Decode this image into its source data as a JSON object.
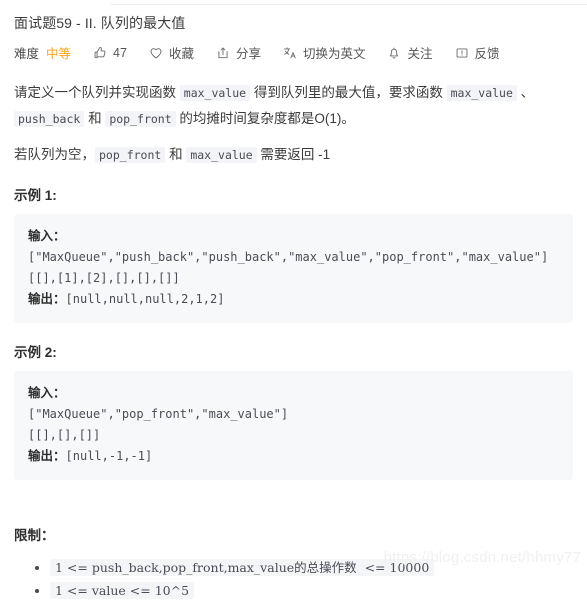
{
  "page": {
    "title": "面试题59 - II. 队列的最大值",
    "watermark": "https://blog.csdn.net/hhmy77"
  },
  "meta_bar": {
    "difficulty_label": "难度",
    "difficulty_value": "中等",
    "difficulty_color": "#ffa116",
    "items": [
      {
        "icon": "thumbs-up-icon",
        "label": "47"
      },
      {
        "icon": "heart-icon",
        "label": "收藏"
      },
      {
        "icon": "share-icon",
        "label": "分享"
      },
      {
        "icon": "translate-icon",
        "label": "切换为英文"
      },
      {
        "icon": "bell-icon",
        "label": "关注"
      },
      {
        "icon": "feedback-icon",
        "label": "反馈"
      }
    ]
  },
  "description": {
    "p1_a": "请定义一个队列并实现函数 ",
    "p1_code1": "max_value",
    "p1_b": " 得到队列里的最大值，要求函数 ",
    "p1_code2": "max_value",
    "p1_c": " 、 ",
    "p1_code3": "push_back",
    "p1_d": " 和 ",
    "p1_code4": "pop_front",
    "p1_e": " 的均摊时间复杂度都是O(1)。",
    "p2_a": "若队列为空，",
    "p2_code1": "pop_front",
    "p2_b": " 和 ",
    "p2_code2": "max_value",
    "p2_c": " 需要返回 -1"
  },
  "examples": [
    {
      "heading": "示例 1:",
      "input_label": "输入：",
      "input_lines": [
        "[\"MaxQueue\",\"push_back\",\"push_back\",\"max_value\",\"pop_front\",\"max_value\"]",
        "[[],[1],[2],[],[],[]]"
      ],
      "output_label": "输出：",
      "output_value": "[null,null,null,2,1,2]"
    },
    {
      "heading": "示例 2:",
      "input_label": "输入：",
      "input_lines": [
        "[\"MaxQueue\",\"pop_front\",\"max_value\"]",
        "[[],[],[]]"
      ],
      "output_label": "输出：",
      "output_value": "[null,-1,-1]"
    }
  ],
  "limits": {
    "heading": "限制：",
    "items": [
      "1 <= push_back,pop_front,max_value的总操作数  <= 10000",
      "1 <= value <= 10^5"
    ]
  }
}
